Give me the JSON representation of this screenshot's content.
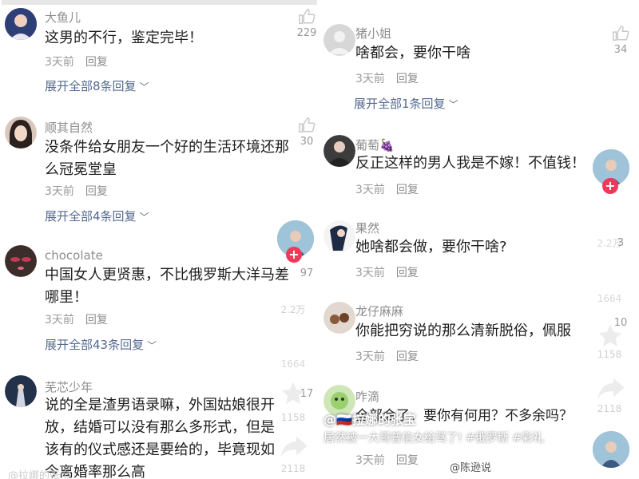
{
  "left": {
    "comments": [
      {
        "username": "大鱼儿",
        "text": "这男的不行，鉴定完毕！",
        "time": "3天前",
        "reply": "回复",
        "expand": "展开全部8条回复",
        "likes": "229"
      },
      {
        "username": "顺其自然",
        "text": "没条件给女朋友一个好的生活环境还那么冠冕堂皇",
        "time": "3天前",
        "reply": "回复",
        "expand": "展开全部4条回复",
        "likes": "30"
      },
      {
        "username": "chocolate",
        "text": "中国女人更贤惠，不比俄罗斯大洋马差哪里！",
        "time": "3天前",
        "reply": "回复",
        "expand": "展开全部43条回复",
        "likes": "97"
      },
      {
        "username": "芜芯少年",
        "text": "说的全是渣男语录嘛，外国姑娘很开放，结婚可以没有那么多形式，但是该有的仪式感还是要给的，毕竟现如今离婚率那么高",
        "likes": "17"
      }
    ],
    "overlay_counts": {
      "share_a": "2.2万",
      "comment_a": "1664",
      "favorite_a": "1158",
      "share_b": "2118"
    },
    "footer_partial": "@拉娜的张宝"
  },
  "right": {
    "comments": [
      {
        "username": "猪小姐",
        "text": "啥都会，要你干啥",
        "time": "3天前",
        "reply": "回复",
        "expand": "展开全部1条回复",
        "likes": "34"
      },
      {
        "username": "葡萄🍇",
        "text": "反正这样的男人我是不嫁！不值钱！",
        "time": "3天前",
        "reply": "回复"
      },
      {
        "username": "果然",
        "text": "她啥都会做，要你干啥?",
        "time": "3天前",
        "reply": "回复",
        "likes": "3"
      },
      {
        "username": "龙仔麻麻",
        "text": "你能把穷说的那么清新脱俗，佩服",
        "time": "3天前",
        "reply": "回复",
        "likes": "10"
      },
      {
        "username": "咋滴",
        "text": "全部会了，要你有何用？不多余吗？",
        "time": "3天前",
        "reply": "回复"
      }
    ],
    "overlay_counts": {
      "share": "2.2万",
      "comment": "1664",
      "favorite": "1158",
      "share2": "2118"
    },
    "video": {
      "user": "@🇷🇺拉娜的张宝",
      "caption": "居然被一大哥普信女给骂了! #俄罗斯 #彩礼"
    },
    "watermark": "@陈逊说"
  }
}
